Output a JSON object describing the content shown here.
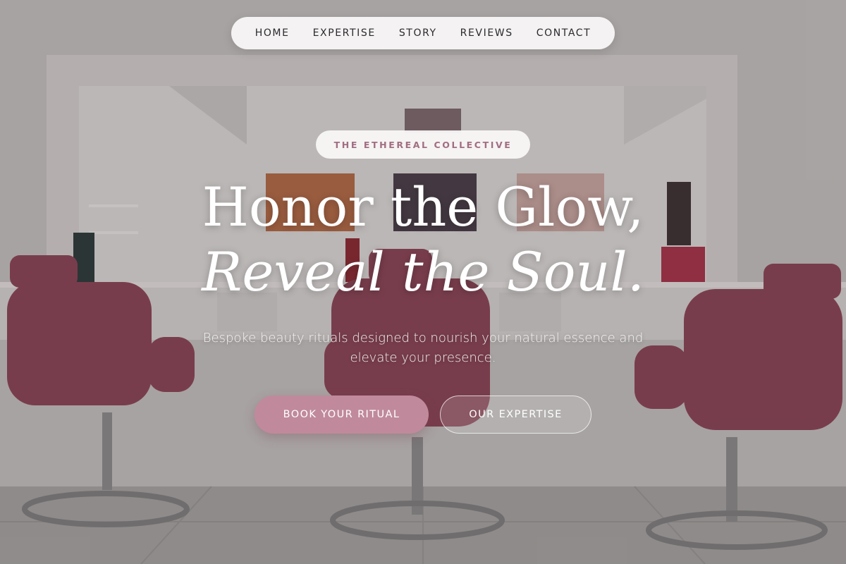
{
  "nav": {
    "items": [
      {
        "label": "HOME"
      },
      {
        "label": "EXPERTISE"
      },
      {
        "label": "STORY"
      },
      {
        "label": "REVIEWS"
      },
      {
        "label": "CONTACT"
      }
    ]
  },
  "hero": {
    "badge": "THE ETHEREAL COLLECTIVE",
    "headline_line1": "Honor the Glow,",
    "headline_line2": "Reveal the Soul.",
    "subtitle": "Bespoke beauty rituals designed to nourish your natural essence and elevate your presence.",
    "primary_cta": "BOOK YOUR RITUAL",
    "secondary_cta": "OUR EXPERTISE",
    "background_image": "salon-interior-with-pink-chairs"
  },
  "colors": {
    "accent": "#c08a9c",
    "badge_text": "#a06e82",
    "nav_text": "#2a2a2e",
    "chair": "#8a4556"
  }
}
